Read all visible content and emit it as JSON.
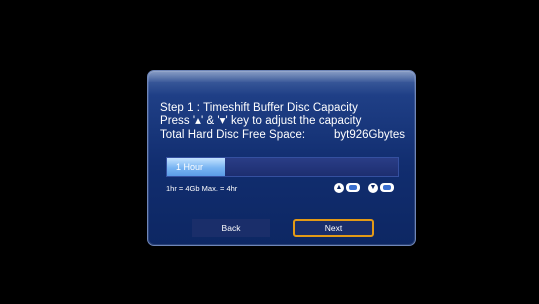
{
  "dialog": {
    "line1": "Step 1 : Timeshift Buffer Disc Capacity",
    "line2": "Press '▴' & '▾' key to adjust the capacity",
    "free_space_label": "Total Hard Disc Free Space:",
    "free_space_value": "byt926Gbytes",
    "progress": {
      "label": "1 Hour",
      "fraction": 0.25
    },
    "hint": "1hr = 4Gb  Max. = 4hr",
    "key_icons": [
      "up-arrow-icon",
      "forward-key-icon",
      "down-arrow-icon",
      "backward-key-icon"
    ],
    "buttons": {
      "back_label": "Back",
      "next_label": "Next"
    }
  },
  "colors": {
    "dialog_bg": "#112d6f",
    "progress_fill": "#78b4f2",
    "focus_border": "#e49a16"
  }
}
